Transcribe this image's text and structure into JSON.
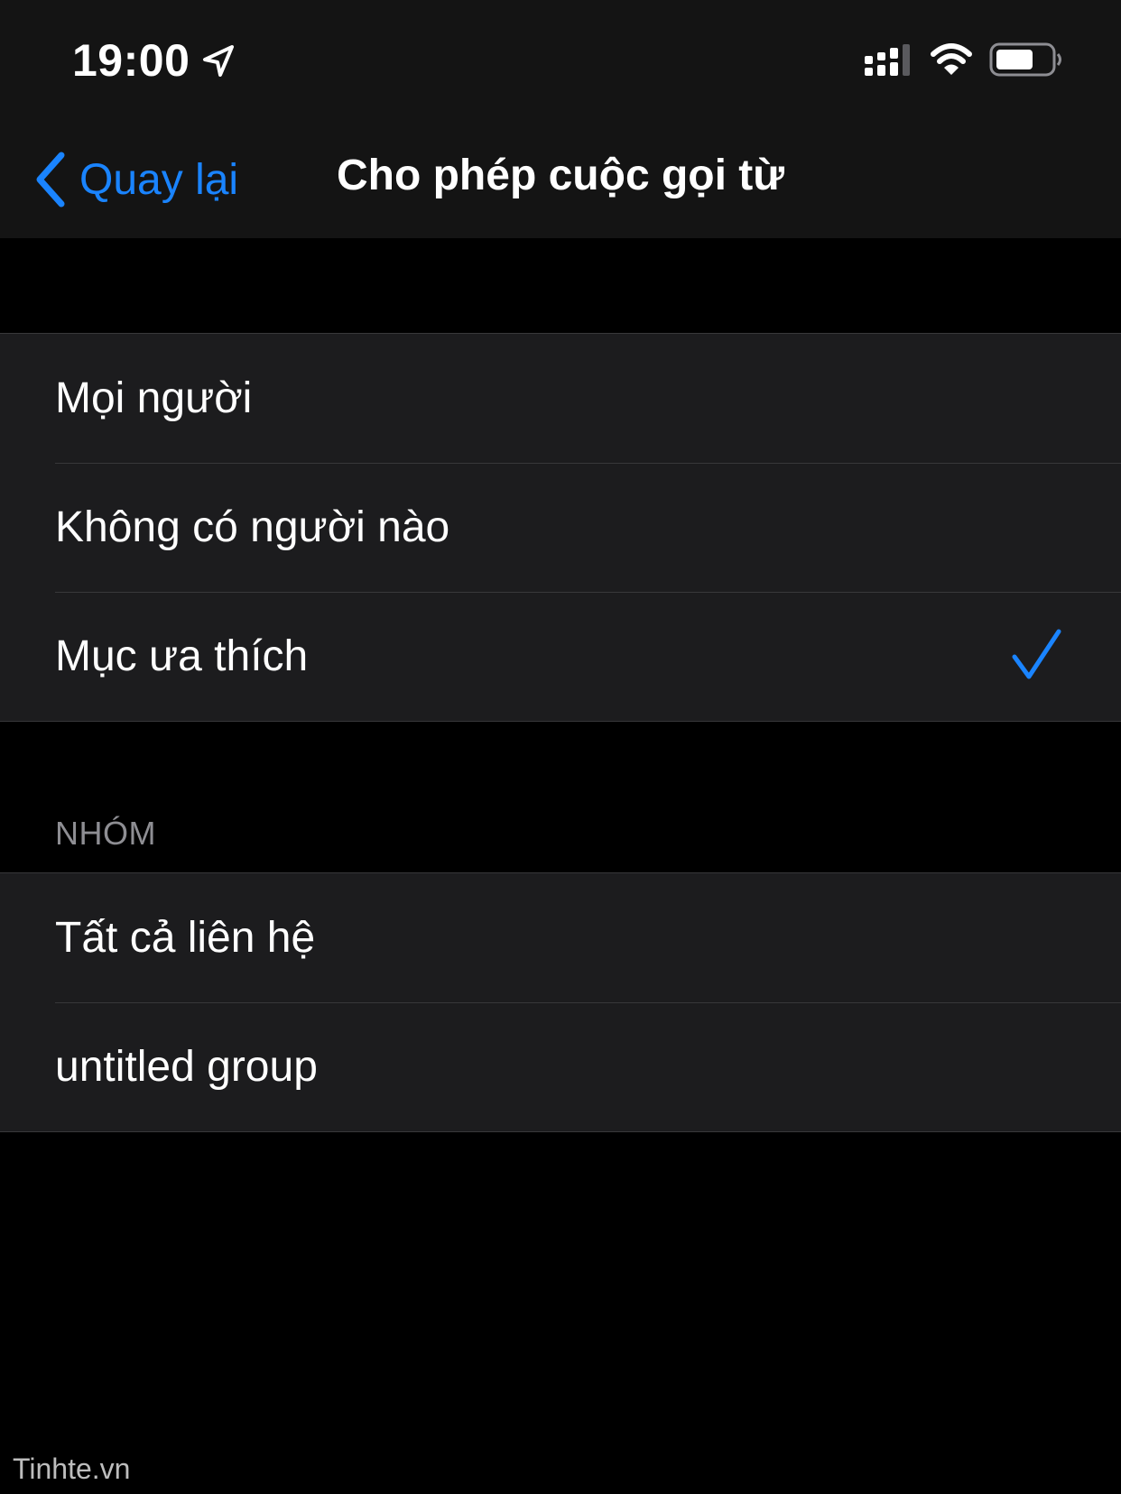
{
  "status_bar": {
    "time": "19:00",
    "icons": [
      "location-arrow-icon",
      "cellular-signal-icon",
      "wifi-icon",
      "battery-icon"
    ]
  },
  "nav": {
    "back_label": "Quay lại",
    "title": "Cho phép cuộc gọi từ"
  },
  "options": [
    {
      "label": "Mọi người",
      "selected": false
    },
    {
      "label": "Không có người nào",
      "selected": false
    },
    {
      "label": "Mục ưa thích",
      "selected": true
    }
  ],
  "groups_section": {
    "header": "NHÓM",
    "items": [
      {
        "label": "Tất cả liên hệ"
      },
      {
        "label": "untitled group"
      }
    ]
  },
  "watermark": "Tinhte.vn",
  "colors": {
    "accent": "#1a84ff",
    "cell_background": "#1c1c1e",
    "bar_background": "#141414",
    "separator": "#38383a",
    "secondary_text": "#8e8e93"
  }
}
